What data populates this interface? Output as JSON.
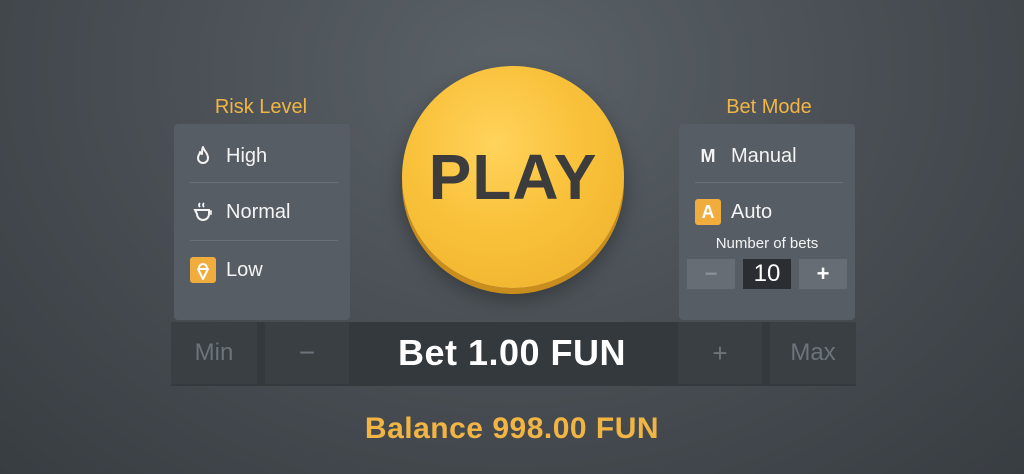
{
  "risk": {
    "title": "Risk Level",
    "options": [
      {
        "label": "High",
        "icon": "flame-icon",
        "selected": false
      },
      {
        "label": "Normal",
        "icon": "cup-icon",
        "selected": false
      },
      {
        "label": "Low",
        "icon": "ice-cream-icon",
        "selected": true
      }
    ]
  },
  "play": {
    "label": "PLAY"
  },
  "mode": {
    "title": "Bet Mode",
    "manual": {
      "badge": "M",
      "label": "Manual",
      "selected": false
    },
    "auto": {
      "badge": "A",
      "label": "Auto",
      "selected": true
    },
    "bets_label": "Number of bets",
    "bets_value": "10",
    "minus": "−",
    "plus": "+"
  },
  "bet": {
    "min": "Min",
    "minus": "−",
    "label": "Bet 1.00 FUN",
    "plus": "+",
    "max": "Max"
  },
  "balance": {
    "label": "Balance 998.00 FUN"
  },
  "colors": {
    "accent": "#f2b544",
    "panel": "#565d64",
    "bar": "#34393e"
  }
}
